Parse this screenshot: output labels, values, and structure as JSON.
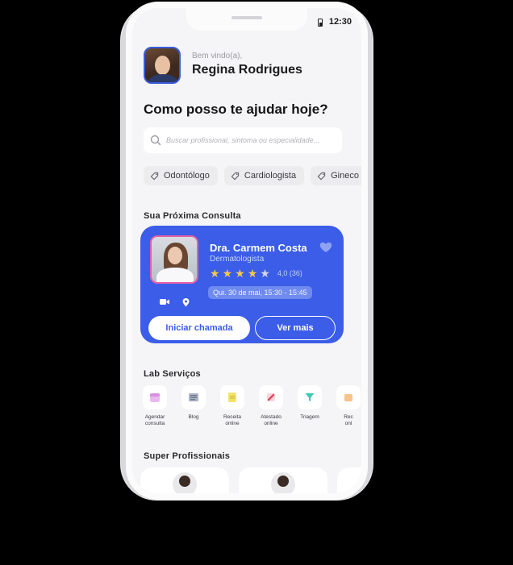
{
  "status": {
    "time": "12:30"
  },
  "header": {
    "greeting": "Bem vindo(a),",
    "user_name": "Regina Rodrigues"
  },
  "headline": "Como posso te ajudar hoje?",
  "search": {
    "placeholder": "Buscar profissional, sintoma ou especialidade..."
  },
  "chips": [
    "Odontólogo",
    "Cardiologista",
    "Gineco"
  ],
  "next_appointment": {
    "section_title": "Sua Próxima Consulta",
    "doctor_name": "Dra. Carmem Costa",
    "specialty": "Dermatologista",
    "stars": 4,
    "rating": "4,0 (36)",
    "slot": "Qui. 30 de mai, 15:30 - 15:45",
    "call_button": "Iniciar chamada",
    "more_button": "Ver mais",
    "colors": {
      "card": "#3b5de7",
      "star": "#f7c948",
      "photo_border": "#e55fa8"
    }
  },
  "lab_services": {
    "section_title": "Lab Serviços",
    "items": [
      {
        "label": "Agendar\nconsulta",
        "icon": "calendar-icon"
      },
      {
        "label": "Blog",
        "icon": "newspaper-icon"
      },
      {
        "label": "Receita\nonline",
        "icon": "prescription-icon"
      },
      {
        "label": "Atestado\nonline",
        "icon": "certificate-icon"
      },
      {
        "label": "Triagem",
        "icon": "funnel-icon"
      },
      {
        "label": "Rec\nonl",
        "icon": "box-icon"
      }
    ]
  },
  "super_pros": {
    "section_title": "Super Profissionais"
  }
}
